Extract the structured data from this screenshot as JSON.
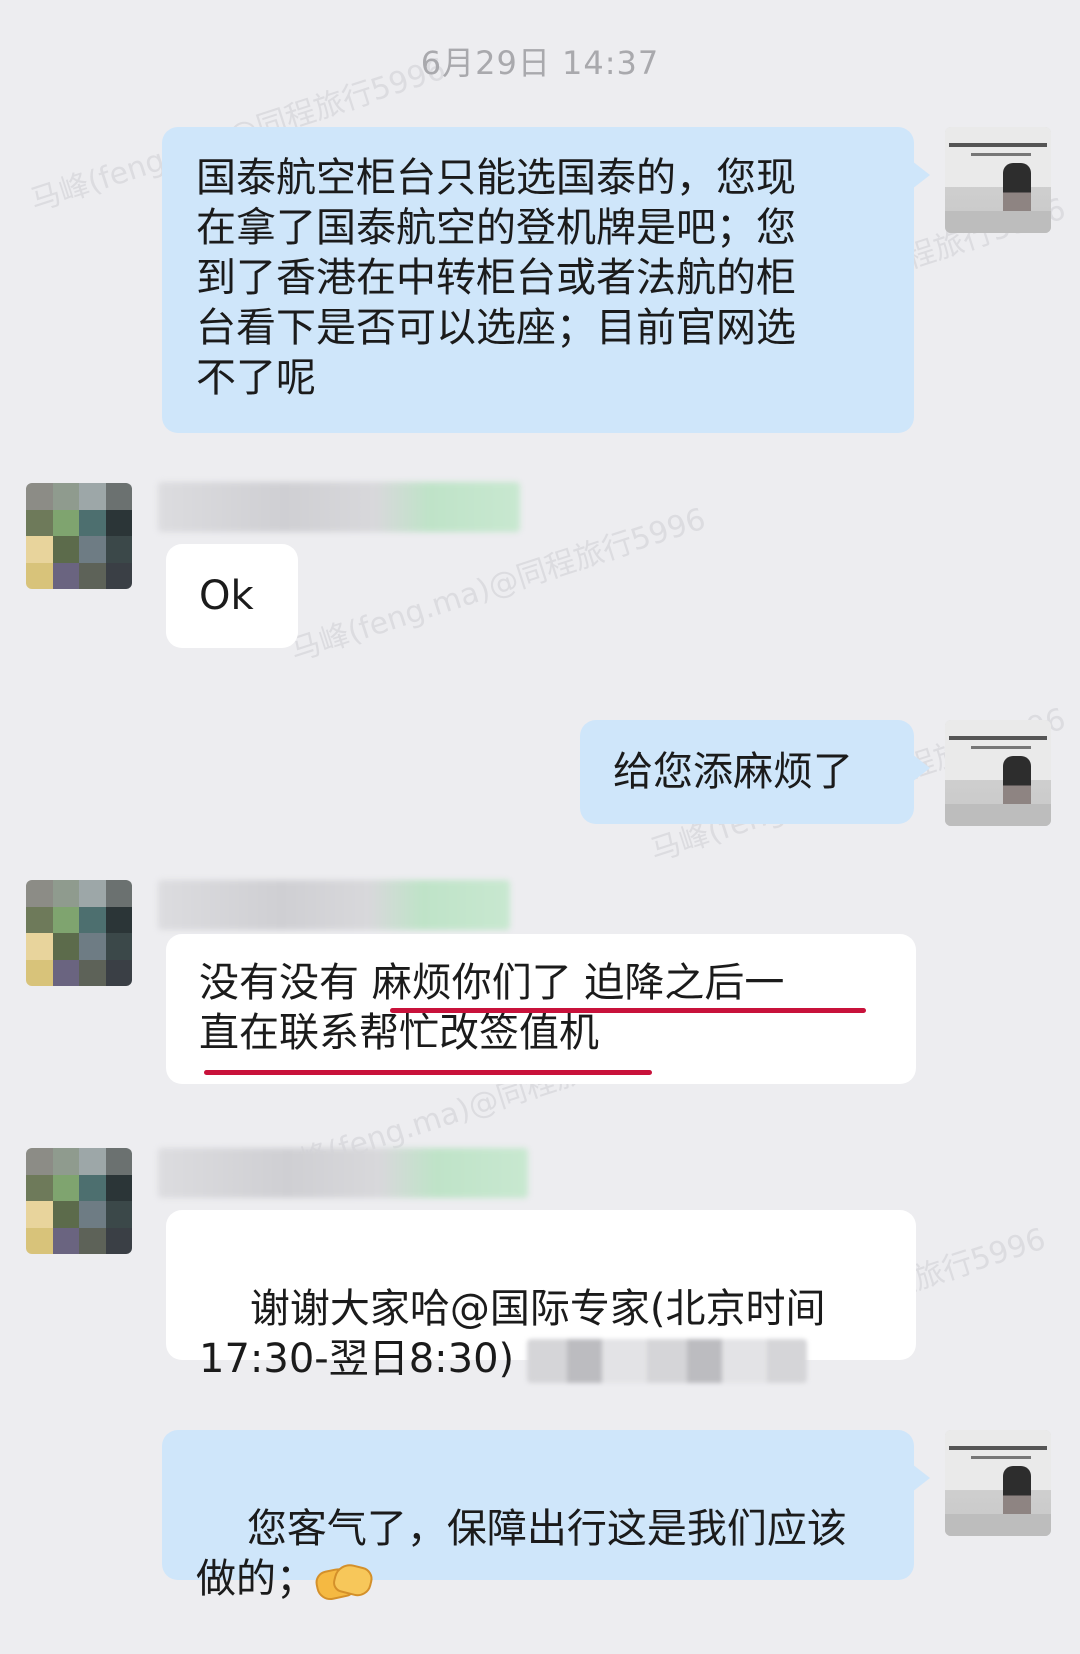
{
  "timestamp": "6月29日  14:37",
  "watermark": "马峰(feng.ma)@同程旅行5996",
  "messages": [
    {
      "side": "out",
      "text": "国泰航空柜台只能选国泰的，您现\n在拿了国泰航空的登机牌是吧；您\n到了香港在中转柜台或者法航的柜\n台看下是否可以选座；目前官网选\n不了呢"
    },
    {
      "side": "in",
      "text": "Ok"
    },
    {
      "side": "out",
      "text": "给您添麻烦了"
    },
    {
      "side": "in",
      "text": "没有没有 麻烦你们了 迫降之后一\n直在联系帮忙改签值机"
    },
    {
      "side": "in",
      "text": "谢谢大家哈@国际专家(北京时间\n17:30-翌日8:30) "
    },
    {
      "side": "out",
      "text": "您客气了，保障出行这是我们应该\n做的；",
      "emoji": "handshake"
    }
  ],
  "colors": {
    "background": "#ededf0",
    "outgoing_bubble": "#cfe6fa",
    "incoming_bubble": "#ffffff",
    "underline": "#c8123b",
    "timestamp": "#a9a9ad"
  },
  "user_avatar_tiles": [
    "#8c8c86",
    "#8f9b8e",
    "#9da7a8",
    "#6b7170",
    "#6e7a5a",
    "#7fa46f",
    "#4d6f6f",
    "#2b3537",
    "#e8d49c",
    "#5c6b4b",
    "#6e7c84",
    "#3b4849",
    "#d8c37a",
    "#6a6480",
    "#5d6258",
    "#3a3f45"
  ]
}
